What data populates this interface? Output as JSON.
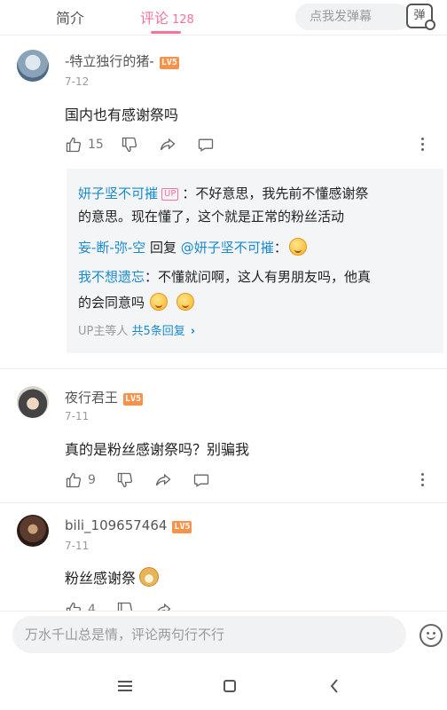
{
  "tabs": {
    "intro": "简介",
    "comments": "评论",
    "comment_count": "128"
  },
  "danmaku": {
    "placeholder": "点我发弹幕",
    "button": "弹"
  },
  "comments": [
    {
      "username": "-特立独行的猪-",
      "level": "LV5",
      "date": "7-12",
      "text": "国内也有感谢祭吗",
      "likes": "15"
    },
    {
      "username": "夜行君王",
      "level": "LV5",
      "date": "7-11",
      "text": "真的是粉丝感谢祭吗？别骗我",
      "likes": "9"
    },
    {
      "username": "bili_109657464",
      "level": "LV5",
      "date": "7-11",
      "text": "粉丝感谢祭",
      "likes": "4"
    }
  ],
  "replies": {
    "r1_user": "妍子坚不可摧",
    "r1_tag": "UP",
    "r1_text_a": "：不好意思，我先前不懂感谢祭",
    "r1_text_b": "的意思。现在懂了，这个就是正常的粉丝活动",
    "r2_user": "妄-断-弥-空",
    "r2_mid": " 回复 ",
    "r2_target": "@妍子坚不可摧",
    "r2_colon": "：",
    "r3_user": "我不想遗忘",
    "r3_text_a": "：不懂就问啊，这人有男朋友吗，他真",
    "r3_text_b": "的会同意吗",
    "more_prefix": "UP主等人 ",
    "more_link": "共5条回复",
    "more_arrow": "›"
  },
  "input": {
    "placeholder": "万水千山总是情，评论两句行不行"
  }
}
